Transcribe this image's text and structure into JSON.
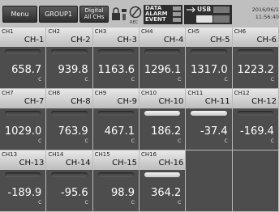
{
  "topbar": {
    "menu_label": "Menu",
    "group_label": "GROUP1",
    "digital_line1": "Digital",
    "digital_line2": "All CHs",
    "rec_label": "REC",
    "status": {
      "line1": "DATA",
      "line2": "ALARM",
      "line3": "EVENT"
    },
    "usb_label": "USB",
    "date": "2016/06/1",
    "time": "11:56:40"
  },
  "channels": [
    {
      "num": "CH1",
      "tag": "CH-1",
      "value": "658.7",
      "unit": "C",
      "bar": "normal"
    },
    {
      "num": "CH2",
      "tag": "CH-2",
      "value": "939.8",
      "unit": "C",
      "bar": "normal"
    },
    {
      "num": "CH3",
      "tag": "CH-3",
      "value": "1163.6",
      "unit": "C",
      "bar": "normal"
    },
    {
      "num": "CH4",
      "tag": "CH-4",
      "value": "1296.1",
      "unit": "C",
      "bar": "normal"
    },
    {
      "num": "CH5",
      "tag": "CH-5",
      "value": "1317.0",
      "unit": "C",
      "bar": "normal"
    },
    {
      "num": "CH6",
      "tag": "CH-6",
      "value": "1223.2",
      "unit": "C",
      "bar": "normal"
    },
    {
      "num": "CH7",
      "tag": "CH-7",
      "value": "1029.0",
      "unit": "C",
      "bar": "normal"
    },
    {
      "num": "CH8",
      "tag": "CH-8",
      "value": "763.9",
      "unit": "C",
      "bar": "normal"
    },
    {
      "num": "CH9",
      "tag": "CH-9",
      "value": "467.1",
      "unit": "C",
      "bar": "normal"
    },
    {
      "num": "CH10",
      "tag": "CH-10",
      "value": "186.2",
      "unit": "C",
      "bar": "active"
    },
    {
      "num": "CH11",
      "tag": "CH-11",
      "value": "-37.4",
      "unit": "C",
      "bar": "active"
    },
    {
      "num": "CH12",
      "tag": "CH-12",
      "value": "-169.4",
      "unit": "C",
      "bar": "normal"
    },
    {
      "num": "CH13",
      "tag": "CH-13",
      "value": "-189.9",
      "unit": "C",
      "bar": "normal"
    },
    {
      "num": "CH14",
      "tag": "CH-14",
      "value": "-95.6",
      "unit": "C",
      "bar": "normal"
    },
    {
      "num": "CH15",
      "tag": "CH-15",
      "value": "98.9",
      "unit": "C",
      "bar": "normal"
    },
    {
      "num": "CH16",
      "tag": "CH-16",
      "value": "364.2",
      "unit": "C",
      "bar": "active"
    }
  ]
}
